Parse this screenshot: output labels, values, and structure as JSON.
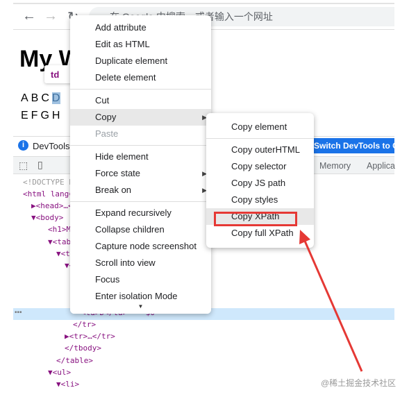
{
  "browser": {
    "address_placeholder": "在 Google 中搜索，或者输入一个网址"
  },
  "page": {
    "heading": "My W",
    "tooltip": "td",
    "row1": [
      "A",
      "B",
      "C",
      "D"
    ],
    "row2": [
      "E",
      "F",
      "G",
      "H"
    ]
  },
  "devtools": {
    "info_text": "DevTools i",
    "switch_button": "Switch DevTools to Chinese",
    "tabs": [
      "Memory",
      "Applica"
    ],
    "tree": [
      {
        "t": "<!DOCTYPE h",
        "i": 0,
        "c": "#999"
      },
      {
        "t": "<html lang=",
        "i": 0
      },
      {
        "t": "▶<head>…</",
        "i": 1
      },
      {
        "t": "▼<body>",
        "i": 1
      },
      {
        "t": "<h1>My",
        "i": 3
      },
      {
        "t": "▼<table>",
        "i": 3
      },
      {
        "t": "▼<tbody",
        "i": 4
      },
      {
        "t": "▼<tr",
        "i": 5
      },
      {
        "t": "<t",
        "i": 7
      },
      {
        "t": "<t",
        "i": 7
      },
      {
        "t": "<t",
        "i": 7
      },
      {
        "t": "<td>D</td> == $0",
        "i": 7
      },
      {
        "t": "</tr>",
        "i": 6
      },
      {
        "t": "▶<tr>…</tr>",
        "i": 5
      },
      {
        "t": "</tbody>",
        "i": 5
      },
      {
        "t": "</table>",
        "i": 4
      },
      {
        "t": "▼<ul>",
        "i": 3
      },
      {
        "t": "▼<li>",
        "i": 4
      }
    ]
  },
  "context_menu": {
    "items": [
      {
        "label": "Add attribute"
      },
      {
        "label": "Edit as HTML"
      },
      {
        "label": "Duplicate element"
      },
      {
        "label": "Delete element"
      },
      {
        "sep": true
      },
      {
        "label": "Cut"
      },
      {
        "label": "Copy",
        "submenu": true,
        "active": true
      },
      {
        "label": "Paste",
        "disabled": true
      },
      {
        "sep": true
      },
      {
        "label": "Hide element"
      },
      {
        "label": "Force state",
        "submenu": true
      },
      {
        "label": "Break on",
        "submenu": true
      },
      {
        "sep": true
      },
      {
        "label": "Expand recursively"
      },
      {
        "label": "Collapse children"
      },
      {
        "label": "Capture node screenshot"
      },
      {
        "label": "Scroll into view"
      },
      {
        "label": "Focus"
      },
      {
        "label": "Enter isolation Mode"
      }
    ]
  },
  "copy_submenu": {
    "items": [
      {
        "label": "Copy element"
      },
      {
        "sep": true
      },
      {
        "label": "Copy outerHTML"
      },
      {
        "label": "Copy selector"
      },
      {
        "label": "Copy JS path"
      },
      {
        "label": "Copy styles"
      },
      {
        "label": "Copy XPath",
        "active": true,
        "highlighted": true
      },
      {
        "label": "Copy full XPath"
      }
    ]
  },
  "annotation": {
    "highlight_color": "#e53935"
  },
  "watermark": "@稀土掘金技术社区"
}
